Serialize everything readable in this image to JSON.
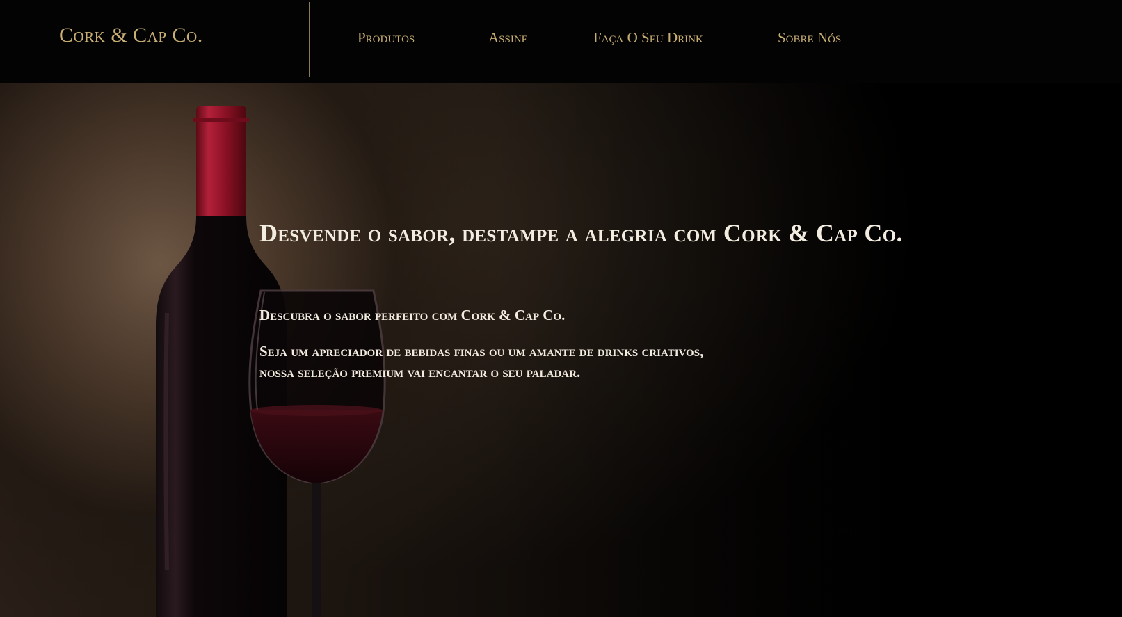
{
  "header": {
    "brand": "Cork & Cap Co.",
    "nav": [
      {
        "label": "Produtos"
      },
      {
        "label": "Assine"
      },
      {
        "label": "Faça O Seu Drink"
      },
      {
        "label": "Sobre Nós"
      }
    ]
  },
  "hero": {
    "headline": "Desvende o sabor, destampe a alegria com Cork & Cap Co.",
    "subtitle": "Descubra o sabor perfeito com Cork & Cap Co.",
    "description_line1": "Seja um apreciador de bebidas finas ou um amante de drinks criativos,",
    "description_line2": "nossa seleção premium vai encantar o seu paladar."
  },
  "colors": {
    "accent_gold": "#c9ae74",
    "text_light": "#f3ece0",
    "background": "#000000",
    "cap_red": "#a3152a"
  }
}
